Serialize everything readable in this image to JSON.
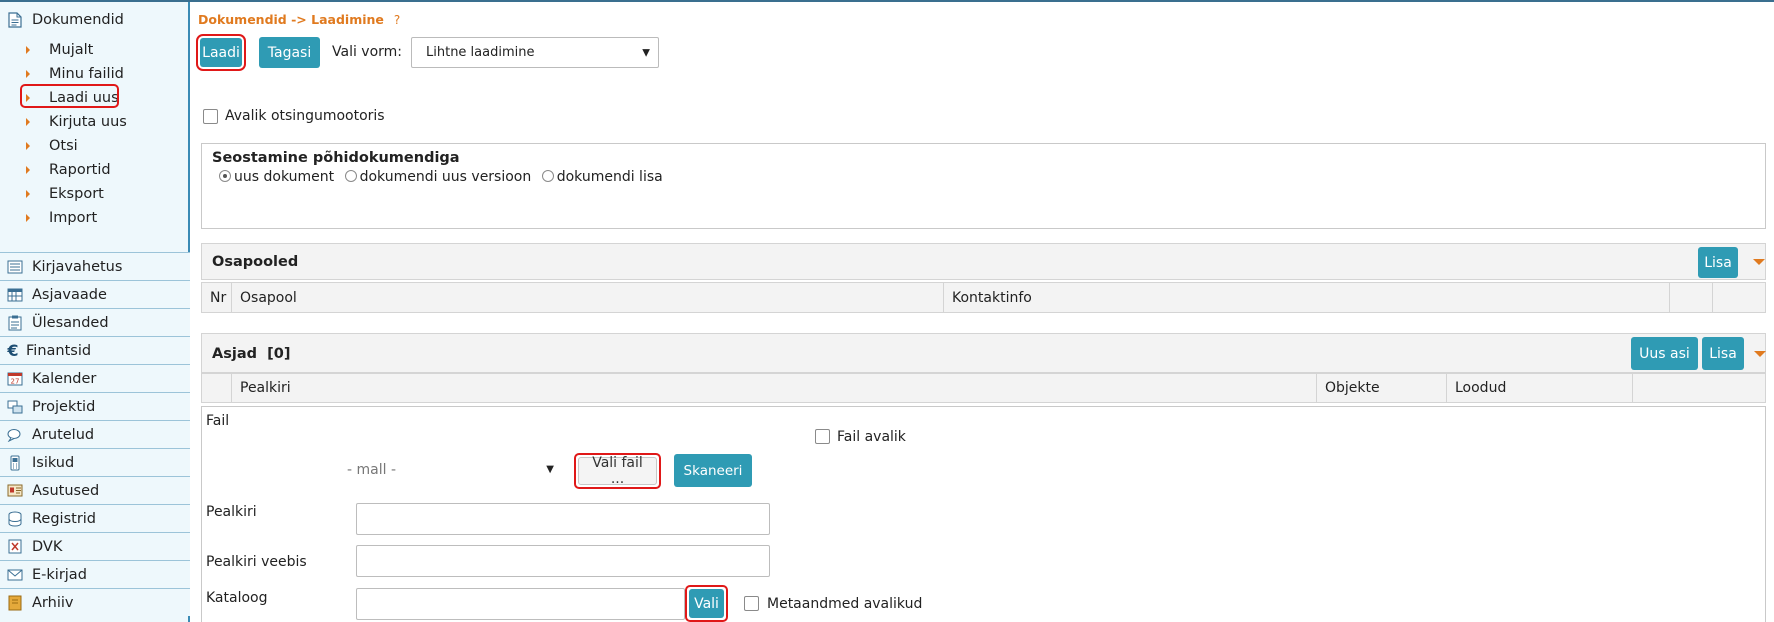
{
  "sidebar": {
    "documents_label": "Dokumendid",
    "sub_items": [
      {
        "label": "Mujalt"
      },
      {
        "label": "Minu failid"
      },
      {
        "label": "Laadi uus"
      },
      {
        "label": "Kirjuta uus"
      },
      {
        "label": "Otsi"
      },
      {
        "label": "Raportid"
      },
      {
        "label": "Eksport"
      },
      {
        "label": "Import"
      }
    ],
    "items": [
      {
        "label": "Kirjavahetus",
        "icon": "mail-list-icon"
      },
      {
        "label": "Asjavaade",
        "icon": "calendar-grid-icon"
      },
      {
        "label": "Ülesanded",
        "icon": "tasks-icon"
      },
      {
        "label": "Finantsid",
        "icon": "euro-icon"
      },
      {
        "label": "Kalender",
        "icon": "calendar-icon"
      },
      {
        "label": "Projektid",
        "icon": "projects-icon"
      },
      {
        "label": "Arutelud",
        "icon": "discussion-icon"
      },
      {
        "label": "Isikud",
        "icon": "phone-icon"
      },
      {
        "label": "Asutused",
        "icon": "card-icon"
      },
      {
        "label": "Registrid",
        "icon": "database-icon"
      },
      {
        "label": "DVK",
        "icon": "dvk-icon"
      },
      {
        "label": "E-kirjad",
        "icon": "envelope-icon"
      },
      {
        "label": "Arhiiv",
        "icon": "archive-icon"
      }
    ]
  },
  "breadcrumb": {
    "text": "Dokumendid -> Laadimine",
    "help": "?"
  },
  "toolbar": {
    "load_label": "Laadi",
    "back_label": "Tagasi",
    "form_label": "Vali vorm:",
    "form_value": "Lihtne laadimine"
  },
  "public_search_label": "Avalik otsingumootoris",
  "link": {
    "title": "Seostamine põhidokumendiga",
    "options": [
      "uus dokument",
      "dokumendi uus versioon",
      "dokumendi lisa"
    ],
    "selected": 0
  },
  "parties": {
    "title": "Osapooled",
    "add_label": "Lisa",
    "columns": [
      "Nr",
      "Osapool",
      "Kontaktinfo"
    ]
  },
  "cases": {
    "title": "Asjad",
    "count": "[0]",
    "new_label": "Uus asi",
    "add_label": "Lisa",
    "columns": [
      "Pealkiri",
      "Objekte",
      "Loodud"
    ]
  },
  "file_section": {
    "file_label": "Fail",
    "file_public_label": "Fail avalik",
    "template_value": "- mall -",
    "choose_file_label": "Vali fail ...",
    "scan_label": "Skaneeri",
    "title_label": "Pealkiri",
    "web_title_label": "Pealkiri veebis",
    "catalog_label": "Kataloog",
    "choose_label": "Vali",
    "metadata_public_label": "Metaandmed avalikud"
  },
  "colors": {
    "accent": "#2f9bb4",
    "orange": "#e07a1f",
    "highlight": "#e01818",
    "sidebar_bg": "#eef8fc"
  }
}
